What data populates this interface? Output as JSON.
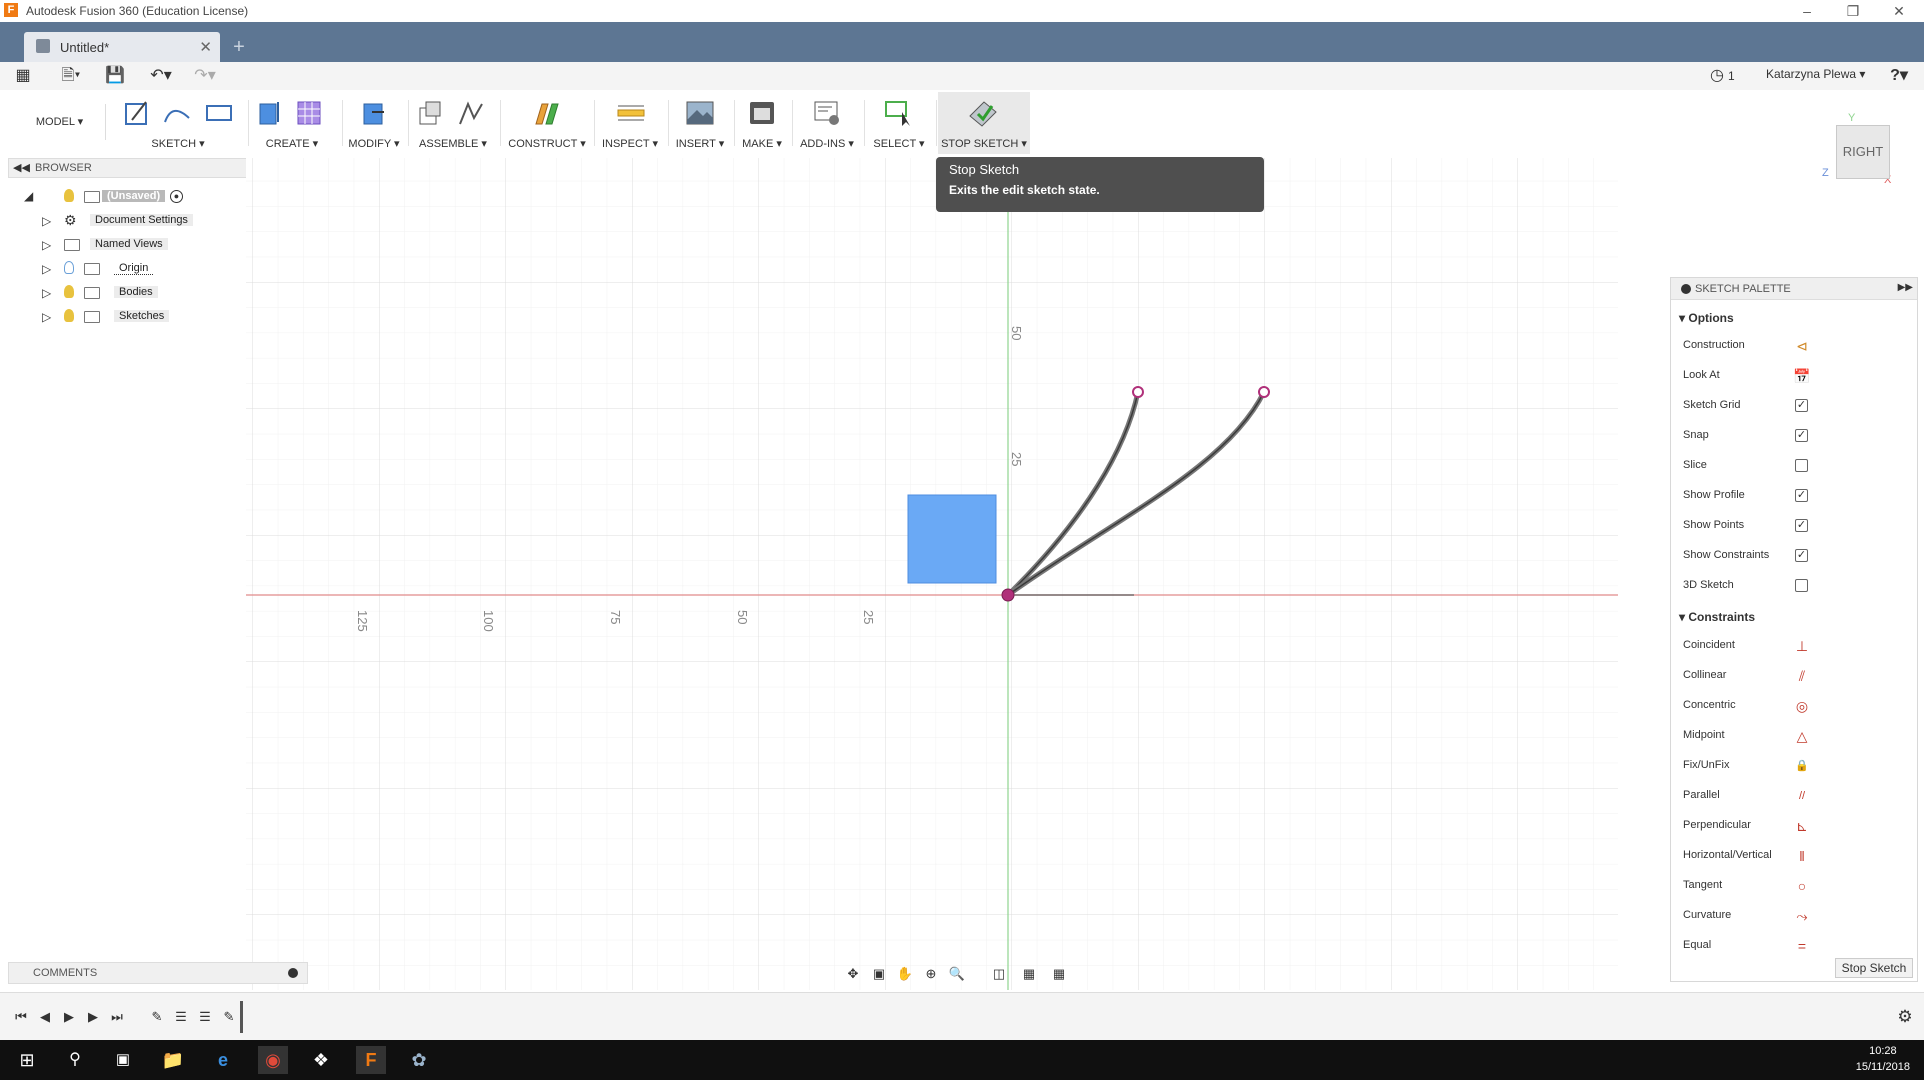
{
  "window": {
    "title": "Autodesk Fusion 360 (Education License)",
    "logo_letter": "F"
  },
  "tabs": {
    "doc_label": "Untitled*",
    "close": "✕",
    "new": "+"
  },
  "qat": {
    "jobs_count": "1",
    "user": "Katarzyna Plewa ▾",
    "help": "?"
  },
  "toolbar": {
    "workspace": "MODEL",
    "groups": [
      "SKETCH",
      "CREATE",
      "MODIFY",
      "ASSEMBLE",
      "CONSTRUCT",
      "INSPECT",
      "INSERT",
      "MAKE",
      "ADD-INS",
      "SELECT",
      "STOP SKETCH"
    ]
  },
  "tooltip": {
    "title": "Stop Sketch",
    "desc": "Exits the edit sketch state."
  },
  "browser": {
    "title": "BROWSER",
    "items": [
      {
        "label": "(Unsaved)"
      },
      {
        "label": "Document Settings"
      },
      {
        "label": "Named Views"
      },
      {
        "label": "Origin"
      },
      {
        "label": "Bodies"
      },
      {
        "label": "Sketches"
      }
    ]
  },
  "viewport": {
    "axis_labels_x": [
      "125",
      "100",
      "75",
      "50",
      "25"
    ],
    "axis_labels_y": [
      "50",
      "25"
    ]
  },
  "viewcube": {
    "face": "RIGHT",
    "axis_y": "Y",
    "axis_z": "Z",
    "axis_x": "X"
  },
  "palette": {
    "title": "SKETCH PALETTE",
    "options_title": "Options",
    "options": [
      {
        "label": "Construction",
        "type": "icon",
        "icon": "construction-icon"
      },
      {
        "label": "Look At",
        "type": "icon",
        "icon": "look-at-icon"
      },
      {
        "label": "Sketch Grid",
        "type": "check",
        "checked": true
      },
      {
        "label": "Snap",
        "type": "check",
        "checked": true
      },
      {
        "label": "Slice",
        "type": "check",
        "checked": false
      },
      {
        "label": "Show Profile",
        "type": "check",
        "checked": true
      },
      {
        "label": "Show Points",
        "type": "check",
        "checked": true
      },
      {
        "label": "Show Constraints",
        "type": "check",
        "checked": true
      },
      {
        "label": "3D Sketch",
        "type": "check",
        "checked": false
      }
    ],
    "constraints_title": "Constraints",
    "constraints": [
      {
        "label": "Coincident",
        "glyph": "⊥"
      },
      {
        "label": "Collinear",
        "glyph": "⫽"
      },
      {
        "label": "Concentric",
        "glyph": "◎"
      },
      {
        "label": "Midpoint",
        "glyph": "△"
      },
      {
        "label": "Fix/UnFix",
        "glyph": "🔒"
      },
      {
        "label": "Parallel",
        "glyph": "//"
      },
      {
        "label": "Perpendicular",
        "glyph": "⊾"
      },
      {
        "label": "Horizontal/Vertical",
        "glyph": "‖"
      },
      {
        "label": "Tangent",
        "glyph": "○"
      },
      {
        "label": "Curvature",
        "glyph": "⤳"
      },
      {
        "label": "Equal",
        "glyph": "="
      }
    ],
    "stop_button": "Stop Sketch"
  },
  "comments": {
    "title": "COMMENTS"
  },
  "taskbar": {
    "time": "10:28",
    "date": "15/11/2018"
  },
  "colors": {
    "tabstrip": "#5d7693",
    "profile": "#6aa9f5",
    "x_axis": "#e08a8a",
    "y_axis": "#8fd48f"
  }
}
